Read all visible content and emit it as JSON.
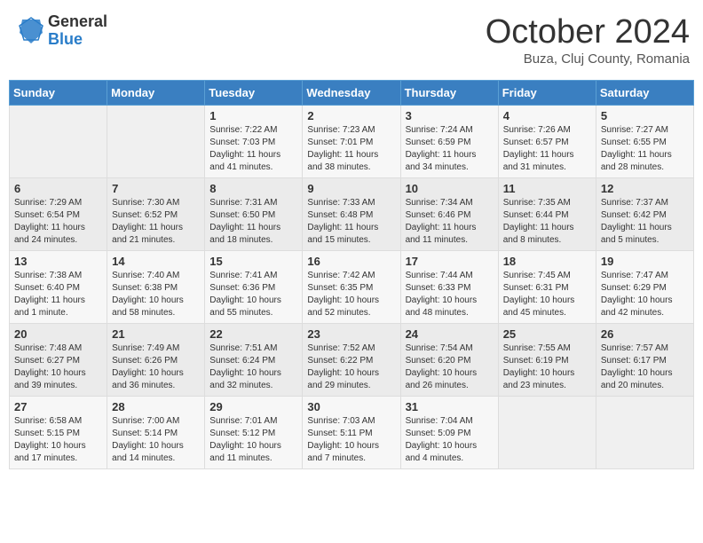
{
  "logo": {
    "general": "General",
    "blue": "Blue"
  },
  "title": "October 2024",
  "location": "Buza, Cluj County, Romania",
  "days": [
    "Sunday",
    "Monday",
    "Tuesday",
    "Wednesday",
    "Thursday",
    "Friday",
    "Saturday"
  ],
  "weeks": [
    [
      {
        "day": "",
        "info": ""
      },
      {
        "day": "",
        "info": ""
      },
      {
        "day": "1",
        "info": "Sunrise: 7:22 AM\nSunset: 7:03 PM\nDaylight: 11 hours and 41 minutes."
      },
      {
        "day": "2",
        "info": "Sunrise: 7:23 AM\nSunset: 7:01 PM\nDaylight: 11 hours and 38 minutes."
      },
      {
        "day": "3",
        "info": "Sunrise: 7:24 AM\nSunset: 6:59 PM\nDaylight: 11 hours and 34 minutes."
      },
      {
        "day": "4",
        "info": "Sunrise: 7:26 AM\nSunset: 6:57 PM\nDaylight: 11 hours and 31 minutes."
      },
      {
        "day": "5",
        "info": "Sunrise: 7:27 AM\nSunset: 6:55 PM\nDaylight: 11 hours and 28 minutes."
      }
    ],
    [
      {
        "day": "6",
        "info": "Sunrise: 7:29 AM\nSunset: 6:54 PM\nDaylight: 11 hours and 24 minutes."
      },
      {
        "day": "7",
        "info": "Sunrise: 7:30 AM\nSunset: 6:52 PM\nDaylight: 11 hours and 21 minutes."
      },
      {
        "day": "8",
        "info": "Sunrise: 7:31 AM\nSunset: 6:50 PM\nDaylight: 11 hours and 18 minutes."
      },
      {
        "day": "9",
        "info": "Sunrise: 7:33 AM\nSunset: 6:48 PM\nDaylight: 11 hours and 15 minutes."
      },
      {
        "day": "10",
        "info": "Sunrise: 7:34 AM\nSunset: 6:46 PM\nDaylight: 11 hours and 11 minutes."
      },
      {
        "day": "11",
        "info": "Sunrise: 7:35 AM\nSunset: 6:44 PM\nDaylight: 11 hours and 8 minutes."
      },
      {
        "day": "12",
        "info": "Sunrise: 7:37 AM\nSunset: 6:42 PM\nDaylight: 11 hours and 5 minutes."
      }
    ],
    [
      {
        "day": "13",
        "info": "Sunrise: 7:38 AM\nSunset: 6:40 PM\nDaylight: 11 hours and 1 minute."
      },
      {
        "day": "14",
        "info": "Sunrise: 7:40 AM\nSunset: 6:38 PM\nDaylight: 10 hours and 58 minutes."
      },
      {
        "day": "15",
        "info": "Sunrise: 7:41 AM\nSunset: 6:36 PM\nDaylight: 10 hours and 55 minutes."
      },
      {
        "day": "16",
        "info": "Sunrise: 7:42 AM\nSunset: 6:35 PM\nDaylight: 10 hours and 52 minutes."
      },
      {
        "day": "17",
        "info": "Sunrise: 7:44 AM\nSunset: 6:33 PM\nDaylight: 10 hours and 48 minutes."
      },
      {
        "day": "18",
        "info": "Sunrise: 7:45 AM\nSunset: 6:31 PM\nDaylight: 10 hours and 45 minutes."
      },
      {
        "day": "19",
        "info": "Sunrise: 7:47 AM\nSunset: 6:29 PM\nDaylight: 10 hours and 42 minutes."
      }
    ],
    [
      {
        "day": "20",
        "info": "Sunrise: 7:48 AM\nSunset: 6:27 PM\nDaylight: 10 hours and 39 minutes."
      },
      {
        "day": "21",
        "info": "Sunrise: 7:49 AM\nSunset: 6:26 PM\nDaylight: 10 hours and 36 minutes."
      },
      {
        "day": "22",
        "info": "Sunrise: 7:51 AM\nSunset: 6:24 PM\nDaylight: 10 hours and 32 minutes."
      },
      {
        "day": "23",
        "info": "Sunrise: 7:52 AM\nSunset: 6:22 PM\nDaylight: 10 hours and 29 minutes."
      },
      {
        "day": "24",
        "info": "Sunrise: 7:54 AM\nSunset: 6:20 PM\nDaylight: 10 hours and 26 minutes."
      },
      {
        "day": "25",
        "info": "Sunrise: 7:55 AM\nSunset: 6:19 PM\nDaylight: 10 hours and 23 minutes."
      },
      {
        "day": "26",
        "info": "Sunrise: 7:57 AM\nSunset: 6:17 PM\nDaylight: 10 hours and 20 minutes."
      }
    ],
    [
      {
        "day": "27",
        "info": "Sunrise: 6:58 AM\nSunset: 5:15 PM\nDaylight: 10 hours and 17 minutes."
      },
      {
        "day": "28",
        "info": "Sunrise: 7:00 AM\nSunset: 5:14 PM\nDaylight: 10 hours and 14 minutes."
      },
      {
        "day": "29",
        "info": "Sunrise: 7:01 AM\nSunset: 5:12 PM\nDaylight: 10 hours and 11 minutes."
      },
      {
        "day": "30",
        "info": "Sunrise: 7:03 AM\nSunset: 5:11 PM\nDaylight: 10 hours and 7 minutes."
      },
      {
        "day": "31",
        "info": "Sunrise: 7:04 AM\nSunset: 5:09 PM\nDaylight: 10 hours and 4 minutes."
      },
      {
        "day": "",
        "info": ""
      },
      {
        "day": "",
        "info": ""
      }
    ]
  ]
}
